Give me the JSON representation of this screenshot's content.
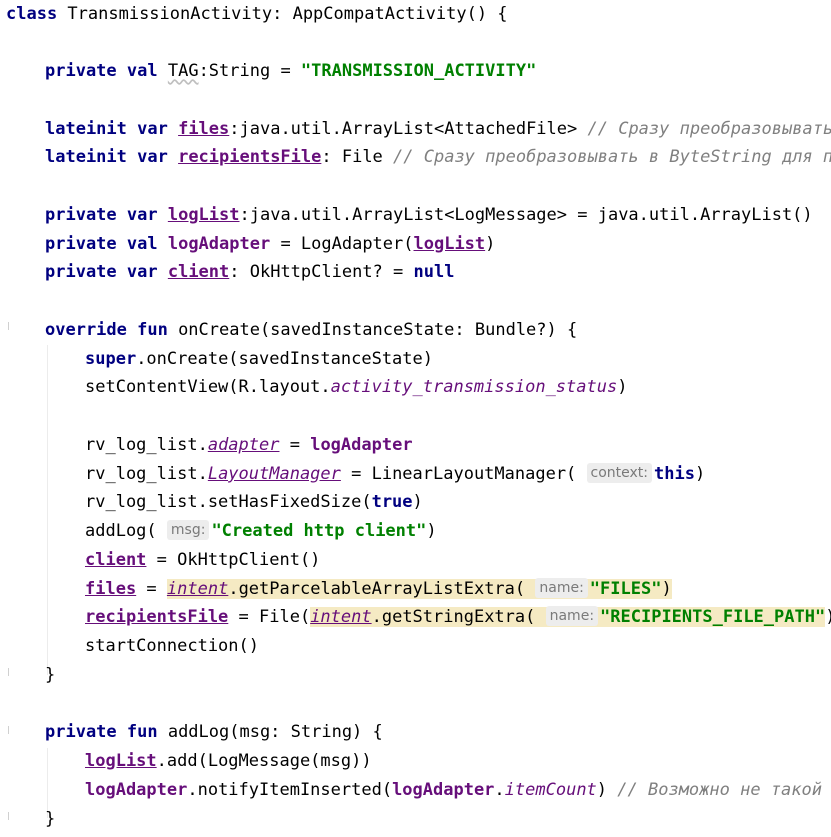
{
  "editor": {
    "colors": {
      "keyword": "#000080",
      "string": "#008000",
      "comment": "#808080",
      "property": "#660e7a",
      "highlight": "#f5eac3",
      "hint_background": "#ededed"
    },
    "lines": {
      "l1": {
        "kw1": "class",
        "t1": " TransmissionActivity: AppCompatActivity() {"
      },
      "l2": {
        "kw1": "private val",
        "t1": " ",
        "sq1": "TAG",
        "t2": ":String = ",
        "s1": "\"TRANSMISSION_ACTIVITY\""
      },
      "l3": {
        "kw1": "lateinit var",
        "t1": " ",
        "p1": "files",
        "t2": ":java.util.ArrayList<AttachedFile> ",
        "c1": "// Сразу преобразовывать в"
      },
      "l4": {
        "kw1": "lateinit var",
        "t1": " ",
        "p1": "recipientsFile",
        "t2": ": File ",
        "c1": "// Сразу преобразовывать в ByteString для пер"
      },
      "l5": {
        "kw1": "private var",
        "t1": " ",
        "p1": "logList",
        "t2": ":java.util.ArrayList<LogMessage> = java.util.ArrayList()"
      },
      "l6": {
        "kw1": "private val",
        "t1": " ",
        "p1": "logAdapter",
        "t2": " = LogAdapter(",
        "p2": "logList",
        "t3": ")"
      },
      "l7": {
        "kw1": "private var",
        "t1": " ",
        "p1": "client",
        "t2": ": OkHttpClient? = ",
        "kw2": "null"
      },
      "l8": {
        "kw1": "override fun",
        "t1": " onCreate(savedInstanceState: Bundle?) {"
      },
      "l9": {
        "kw1": "super",
        "t1": ".onCreate(savedInstanceState)"
      },
      "l10": {
        "t1": "setContentView(R.layout.",
        "pi1": "activity_transmission_status",
        "t2": ")"
      },
      "l11": {
        "t1": "rv_log_list.",
        "pi1": "adapter",
        "t2": " = ",
        "p1": "logAdapter"
      },
      "l12": {
        "t1": "rv_log_list.",
        "pi1": "LayoutManager",
        "t2": " = LinearLayoutManager( ",
        "h1": "context:",
        "kw1": "this",
        "t3": ")"
      },
      "l13": {
        "t1": "rv_log_list.setHasFixedSize(",
        "kw1": "true",
        "t2": ")"
      },
      "l14": {
        "t1": "addLog( ",
        "h1": "msg:",
        "s1": "\"Created http client\"",
        "t2": ")"
      },
      "l15": {
        "p1": "client",
        "t1": " = OkHttpClient()"
      },
      "l16": {
        "p1": "files",
        "t1": " = ",
        "pi1": "intent",
        "t2": ".getParcelableArrayListExtra( ",
        "h1": "name:",
        "s1": "\"FILES\"",
        "t3": ")"
      },
      "l17": {
        "p1": "recipientsFile",
        "t1": " = File(",
        "pi1": "intent",
        "t2": ".getStringExtra( ",
        "h1": "name:",
        "s1": "\"RECIPIENTS_FILE_PATH\"",
        "t3": "))"
      },
      "l18": {
        "t1": "startConnection()"
      },
      "l19": {
        "t1": "}"
      },
      "l20": {
        "kw1": "private fun",
        "t1": " addLog(msg: String) {"
      },
      "l21": {
        "p1": "logList",
        "t1": ".add(LogMessage(msg))"
      },
      "l22": {
        "p1": "logAdapter",
        "t1": ".notifyItemInserted(",
        "p2": "logAdapter",
        "t2": ".",
        "pi1": "itemCount",
        "t3": ") ",
        "c1": "// Возможно не такой ин"
      },
      "l23": {
        "t1": "}"
      }
    }
  }
}
